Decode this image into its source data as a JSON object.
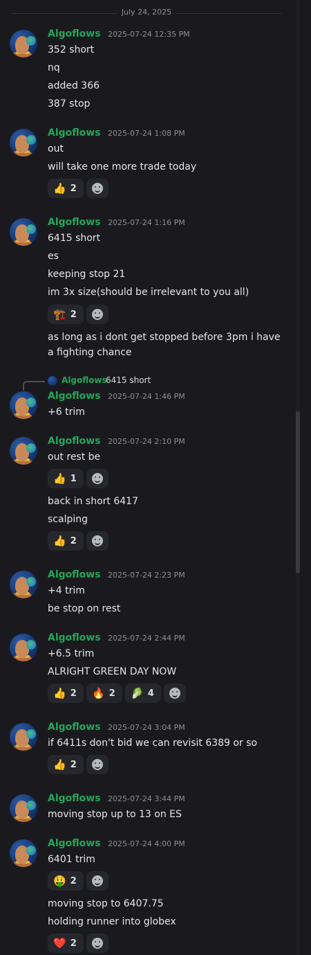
{
  "date_divider": "July 24, 2025",
  "username": "Algoflows",
  "messages": [
    {
      "timestamp": "2025-07-24 12:35 PM",
      "lines": [
        "352 short",
        "nq",
        "added 366",
        "387 stop"
      ]
    },
    {
      "timestamp": "2025-07-24 1:08 PM",
      "lines": [
        "out",
        "will take one more trade today"
      ],
      "reactions": [
        {
          "emoji": "👍",
          "count": "2"
        }
      ]
    },
    {
      "timestamp": "2025-07-24 1:16 PM",
      "lines": [
        "6415 short",
        "es",
        "keeping stop 21",
        "im 3x size(should be irrelevant to you all)"
      ],
      "reactions": [
        {
          "emoji": "🏗️",
          "count": "2"
        }
      ],
      "after_lines": [
        "as long as i dont get stopped before 3pm i have",
        "a fighting chance"
      ]
    },
    {
      "reply": {
        "name": "Algoflows",
        "text": "6415 short"
      },
      "timestamp": "2025-07-24 1:46 PM",
      "lines": [
        "+6 trim"
      ]
    },
    {
      "timestamp": "2025-07-24 2:10 PM",
      "lines": [
        "out rest be"
      ],
      "reactions": [
        {
          "emoji": "👍",
          "count": "1"
        }
      ],
      "after_lines": [
        "back in short 6417",
        "scalping"
      ],
      "reactions2": [
        {
          "emoji": "👍",
          "count": "2"
        }
      ]
    },
    {
      "timestamp": "2025-07-24 2:23 PM",
      "lines": [
        "+4 trim",
        "be stop on rest"
      ]
    },
    {
      "timestamp": "2025-07-24 2:44 PM",
      "lines": [
        "+6.5 trim",
        "ALRIGHT GREEN DAY NOW"
      ],
      "reactions": [
        {
          "emoji": "👍",
          "count": "2"
        },
        {
          "emoji": "🔥",
          "count": "2"
        },
        {
          "emoji": "🥬",
          "count": "4"
        }
      ]
    },
    {
      "timestamp": "2025-07-24 3:04 PM",
      "lines": [
        "if 6411s don't bid we can revisit 6389 or so"
      ],
      "reactions": [
        {
          "emoji": "👍",
          "count": "2"
        }
      ]
    },
    {
      "timestamp": "2025-07-24 3:44 PM",
      "lines": [
        "moving stop up to 13 on ES"
      ]
    },
    {
      "timestamp": "2025-07-24 4:00 PM",
      "lines": [
        "6401 trim"
      ],
      "reactions": [
        {
          "emoji": "🤑",
          "count": "2"
        }
      ],
      "after_lines": [
        "moving stop to 6407.75",
        "holding runner into globex"
      ],
      "reactions2": [
        {
          "emoji": "❤️",
          "count": "2"
        }
      ]
    }
  ],
  "icons": {
    "add_reaction": "smiley-add-icon",
    "avatar": "avatar-image"
  }
}
